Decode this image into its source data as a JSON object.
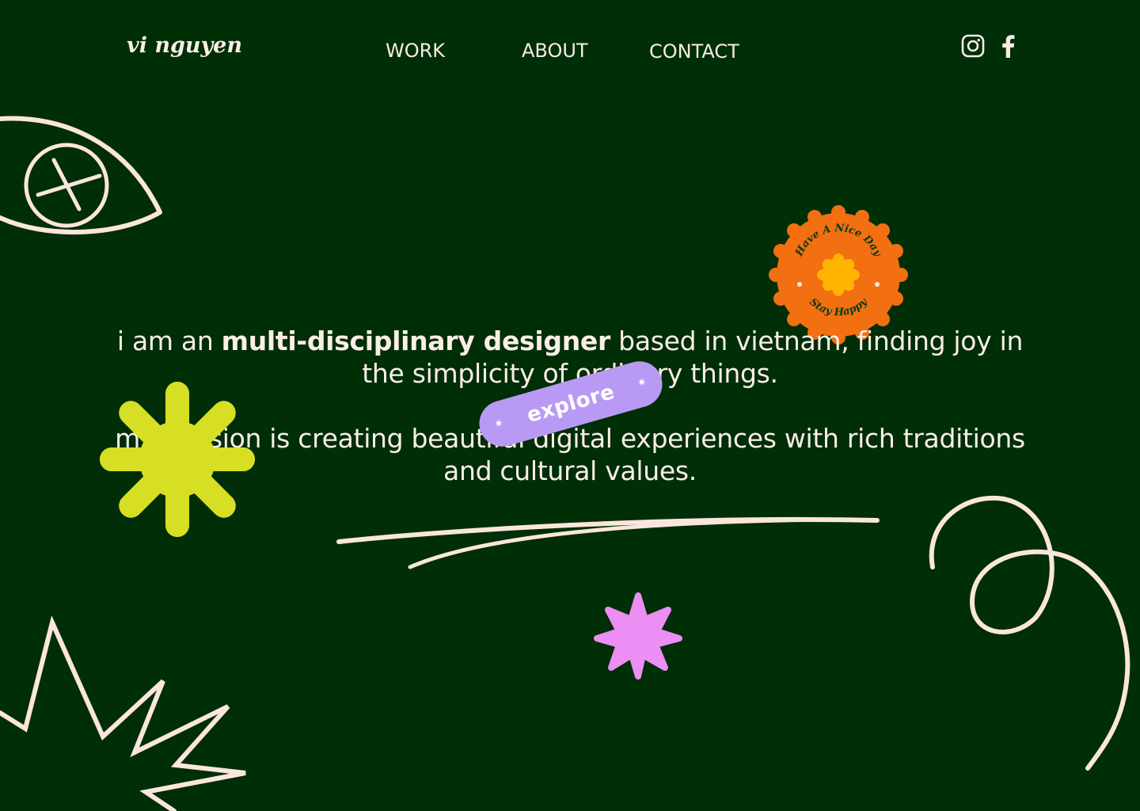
{
  "brand": {
    "logo_text": "vi nguyen"
  },
  "nav": {
    "items": [
      {
        "label": "WORK"
      },
      {
        "label": "ABOUT"
      },
      {
        "label": "CONTACT"
      }
    ]
  },
  "social": {
    "icons": [
      "instagram-icon",
      "facebook-icon"
    ]
  },
  "badge": {
    "top_text": "Have A Nice Day",
    "bottom_text": "Stay Happy",
    "color": "#f26f12",
    "flower_color": "#ffb400"
  },
  "hero": {
    "line1_before": "i am an ",
    "line1_bold": "multi-disciplinary designer",
    "line1_after": " based in vietnam, finding joy in the simplicity of ordinary things.",
    "line2": "my passion is creating beautiful digital experiences with rich traditions and cultural values."
  },
  "cta": {
    "label": "explore",
    "color": "#b89af4"
  },
  "colors": {
    "background": "#002e07",
    "text": "#f6ece4",
    "lime_flower": "#d6df24",
    "pink_star": "#ec8ef4",
    "line_art": "#fbe6dc"
  }
}
